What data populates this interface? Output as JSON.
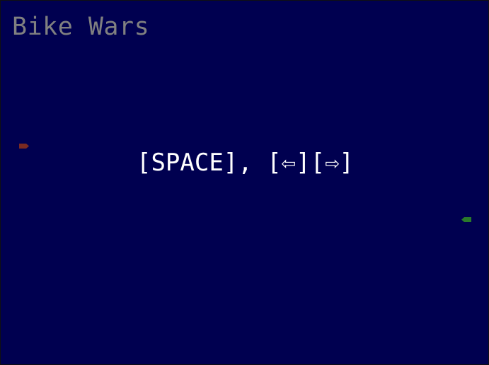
{
  "game": {
    "title": "Bike Wars",
    "controls_hint": "[SPACE], [⇦][⇨]",
    "background_color": "#000050",
    "title_color": "#808080"
  },
  "players": [
    {
      "id": "player-1",
      "color": "#7a2a22",
      "facing": "right"
    },
    {
      "id": "player-2",
      "color": "#2a7a2a",
      "facing": "left"
    }
  ]
}
